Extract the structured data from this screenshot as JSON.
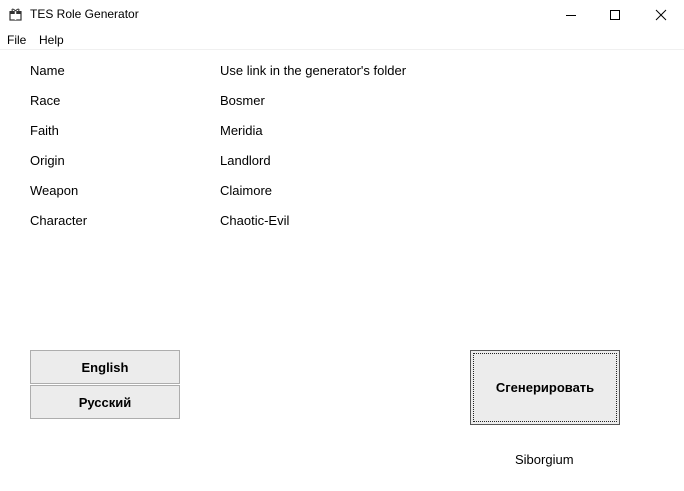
{
  "window": {
    "title": "TES Role Generator",
    "icon": "gift-icon"
  },
  "menu": {
    "file": "File",
    "help": "Help"
  },
  "fields": [
    {
      "label": "Name",
      "value": "Use link in the generator's folder"
    },
    {
      "label": "Race",
      "value": "Bosmer"
    },
    {
      "label": "Faith",
      "value": "Meridia"
    },
    {
      "label": "Origin",
      "value": "Landlord"
    },
    {
      "label": "Weapon",
      "value": "Claimore"
    },
    {
      "label": "Character",
      "value": "Chaotic-Evil"
    }
  ],
  "buttons": {
    "english": "English",
    "russian": "Русский",
    "generate": "Сгенерировать"
  },
  "author": "Siborgium",
  "colors": {
    "background": "#ffffff",
    "button_face": "#ececec",
    "button_border": "#adadad"
  }
}
